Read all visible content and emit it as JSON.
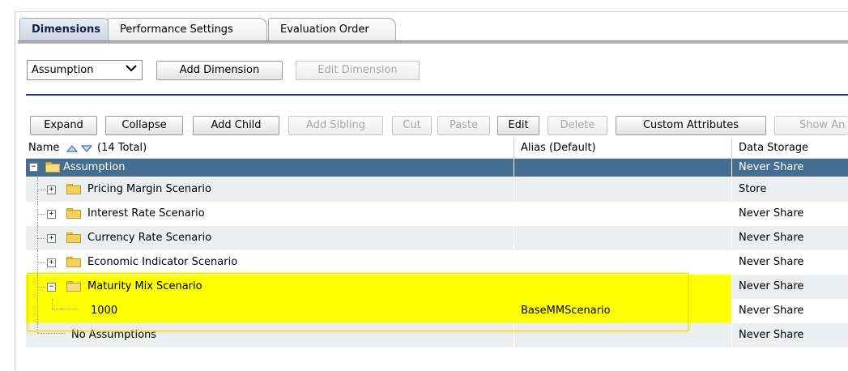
{
  "tabs": [
    {
      "label": "Dimensions",
      "active": true
    },
    {
      "label": "Performance Settings",
      "active": false
    },
    {
      "label": "Evaluation Order",
      "active": false
    }
  ],
  "dimension_select": {
    "value": "Assumption"
  },
  "top_buttons": {
    "add_dimension": "Add Dimension",
    "edit_dimension": "Edit Dimension"
  },
  "toolbar": {
    "expand": "Expand",
    "collapse": "Collapse",
    "add_child": "Add Child",
    "add_sibling": "Add Sibling",
    "cut": "Cut",
    "paste": "Paste",
    "edit": "Edit",
    "delete": "Delete",
    "custom_attributes": "Custom Attributes",
    "show_ancestors": "Show An"
  },
  "grid": {
    "headers": {
      "name": "Name",
      "total": "(14 Total)",
      "alias": "Alias  (Default)",
      "storage": "Data Storage"
    },
    "rows": [
      {
        "name": "Assumption",
        "alias": "",
        "storage": "Never Share"
      },
      {
        "name": "Pricing Margin Scenario",
        "alias": "",
        "storage": "Store"
      },
      {
        "name": "Interest Rate Scenario",
        "alias": "",
        "storage": "Never Share"
      },
      {
        "name": "Currency Rate Scenario",
        "alias": "",
        "storage": "Never Share"
      },
      {
        "name": "Economic Indicator Scenario",
        "alias": "",
        "storage": "Never Share"
      },
      {
        "name": "Maturity Mix Scenario",
        "alias": "",
        "storage": "Never Share"
      },
      {
        "name": "1000",
        "alias": "BaseMMScenario",
        "storage": "Never Share"
      },
      {
        "name": "No Assumptions",
        "alias": "",
        "storage": "Never Share"
      }
    ]
  },
  "colors": {
    "selected_row": "#446d8f",
    "highlight": "#ffff00",
    "separator": "#1f3e73"
  }
}
